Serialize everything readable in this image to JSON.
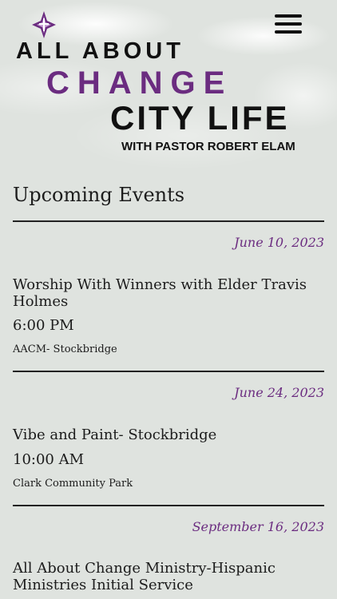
{
  "header": {
    "brand_line1": "ALL ABOUT",
    "brand_line2": "CHANGE",
    "brand_line3": "CITY LIFE",
    "brand_line4": "WITH PASTOR ROBERT ELAM",
    "logo_icon": "cross-star-icon",
    "menu_icon": "hamburger-menu-icon"
  },
  "colors": {
    "accent": "#6b2c80",
    "text": "#1c1c1c",
    "background": "#dfe3df"
  },
  "events": {
    "heading": "Upcoming Events",
    "items": [
      {
        "date": "June 10, 2023",
        "title": "Worship With Winners with Elder Travis Holmes",
        "time": "6:00 PM",
        "venue": "AACM- Stockbridge"
      },
      {
        "date": "June 24, 2023",
        "title": "Vibe and Paint- Stockbridge",
        "time": "10:00 AM",
        "venue": "Clark Community Park"
      },
      {
        "date": "September 16, 2023",
        "title": "All About Change Ministry-Hispanic Ministries Initial Service"
      }
    ]
  }
}
